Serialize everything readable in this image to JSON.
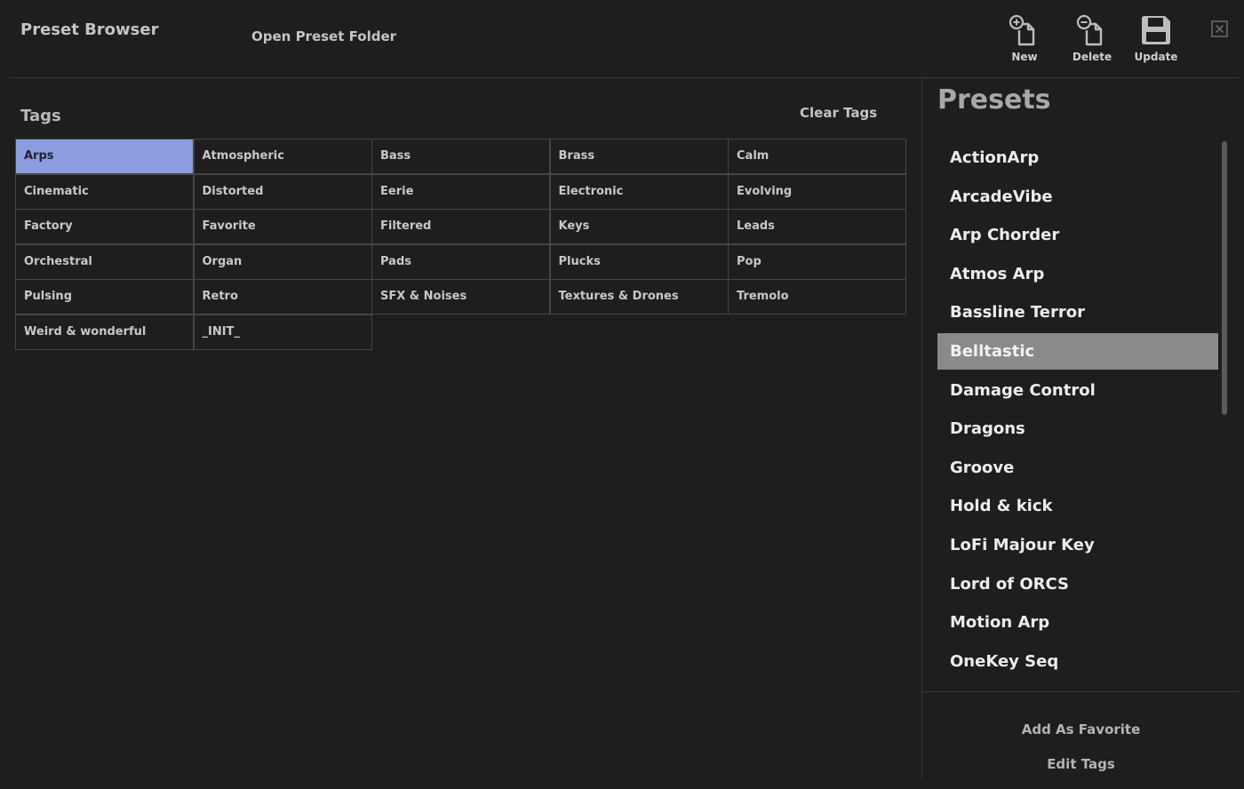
{
  "header": {
    "title": "Preset Browser",
    "open_folder": "Open Preset Folder",
    "tools": [
      {
        "label": "New",
        "icon": "file-plus-icon"
      },
      {
        "label": "Delete",
        "icon": "file-minus-icon"
      },
      {
        "label": "Update",
        "icon": "save-icon"
      }
    ],
    "close_icon": "close-icon"
  },
  "tags": {
    "heading": "Tags",
    "clear_label": "Clear Tags",
    "selected": "Arps",
    "selected_color": "#8c9ee0",
    "items": [
      "Arps",
      "Atmospheric",
      "Bass",
      "Brass",
      "Calm",
      "Cinematic",
      "Distorted",
      "Eerie",
      "Electronic",
      "Evolving",
      "Factory",
      "Favorite",
      "Filtered",
      "Keys",
      "Leads",
      "Orchestral",
      "Organ",
      "Pads",
      "Plucks",
      "Pop",
      "Pulsing",
      "Retro",
      "SFX & Noises",
      "Textures & Drones",
      "Tremolo",
      "Weird & wonderful",
      "_INIT_"
    ]
  },
  "presets": {
    "heading": "Presets",
    "selected": "Belltastic",
    "items": [
      "ActionArp",
      "ArcadeVibe",
      "Arp Chorder",
      "Atmos Arp",
      "Bassline Terror",
      "Belltastic",
      "Damage Control",
      "Dragons",
      "Groove",
      "Hold & kick",
      "LoFi Majour Key",
      "Lord of ORCS",
      "Motion Arp",
      "OneKey Seq"
    ]
  },
  "footer": {
    "add_favorite": "Add As Favorite",
    "edit_tags": "Edit Tags"
  }
}
